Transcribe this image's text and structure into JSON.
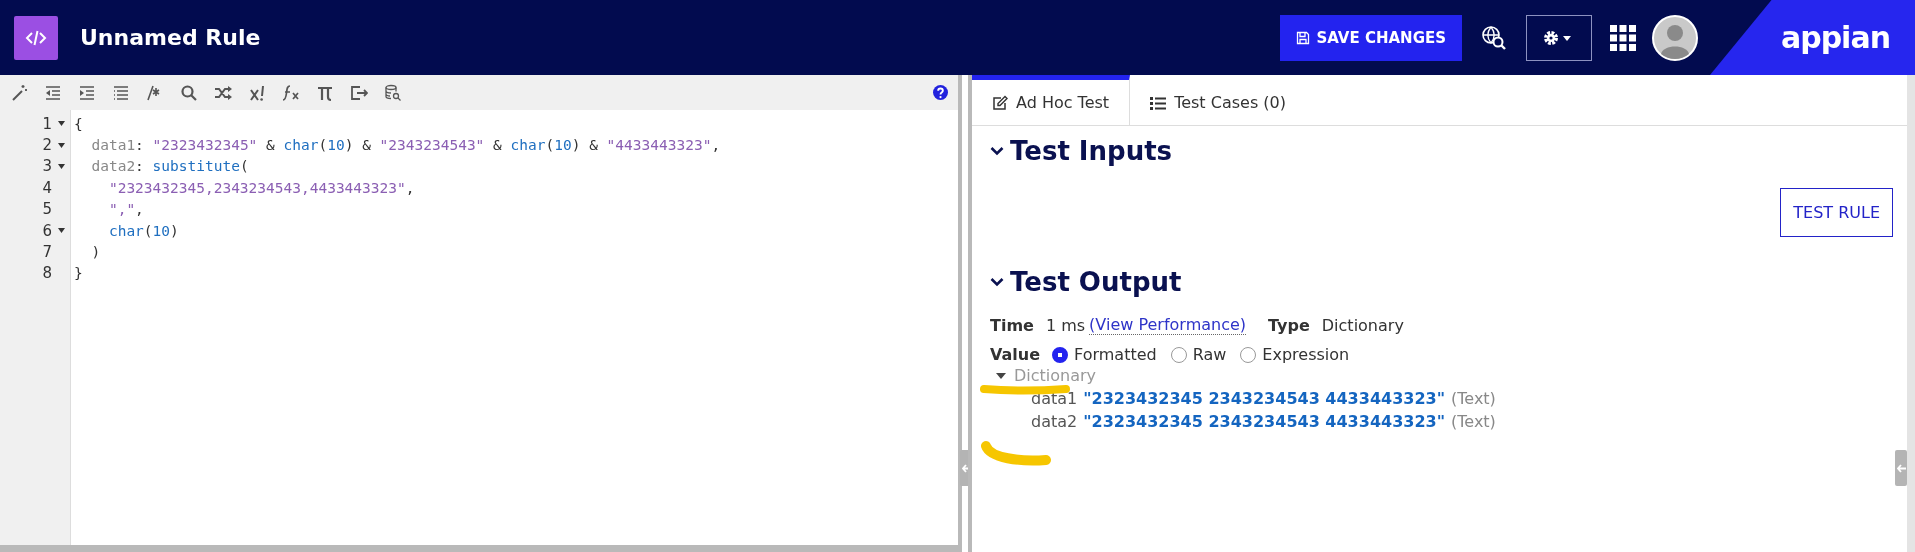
{
  "header": {
    "title": "Unnamed Rule",
    "save_button": "SAVE CHANGES",
    "brand": "appian"
  },
  "editor": {
    "lines": [
      {
        "number": "1",
        "foldable": true,
        "tokens": [
          {
            "kind": "punct",
            "text": "{"
          }
        ]
      },
      {
        "number": "2",
        "foldable": true,
        "tokens": [
          {
            "kind": "key",
            "text": "  data1"
          },
          {
            "kind": "punct",
            "text": ": "
          },
          {
            "kind": "string",
            "text": "\"2323432345\""
          },
          {
            "kind": "punct",
            "text": " & "
          },
          {
            "kind": "func",
            "text": "char"
          },
          {
            "kind": "punct",
            "text": "("
          },
          {
            "kind": "number",
            "text": "10"
          },
          {
            "kind": "punct",
            "text": ") & "
          },
          {
            "kind": "string",
            "text": "\"2343234543\""
          },
          {
            "kind": "punct",
            "text": " & "
          },
          {
            "kind": "func",
            "text": "char"
          },
          {
            "kind": "punct",
            "text": "("
          },
          {
            "kind": "number",
            "text": "10"
          },
          {
            "kind": "punct",
            "text": ") & "
          },
          {
            "kind": "string",
            "text": "\"4433443323\""
          },
          {
            "kind": "punct",
            "text": ","
          }
        ]
      },
      {
        "number": "3",
        "foldable": true,
        "tokens": [
          {
            "kind": "key",
            "text": "  data2"
          },
          {
            "kind": "punct",
            "text": ": "
          },
          {
            "kind": "func",
            "text": "substitute"
          },
          {
            "kind": "punct",
            "text": "("
          }
        ]
      },
      {
        "number": "4",
        "foldable": false,
        "tokens": [
          {
            "kind": "string",
            "text": "    \"2323432345,2343234543,4433443323\""
          },
          {
            "kind": "punct",
            "text": ","
          }
        ]
      },
      {
        "number": "5",
        "foldable": false,
        "tokens": [
          {
            "kind": "string",
            "text": "    \",\""
          },
          {
            "kind": "punct",
            "text": ","
          }
        ]
      },
      {
        "number": "6",
        "foldable": true,
        "tokens": [
          {
            "kind": "func",
            "text": "    char"
          },
          {
            "kind": "punct",
            "text": "("
          },
          {
            "kind": "number",
            "text": "10"
          },
          {
            "kind": "punct",
            "text": ")"
          }
        ]
      },
      {
        "number": "7",
        "foldable": false,
        "tokens": [
          {
            "kind": "punct",
            "text": "  )"
          }
        ]
      },
      {
        "number": "8",
        "foldable": false,
        "tokens": [
          {
            "kind": "punct",
            "text": "}"
          }
        ]
      }
    ]
  },
  "tabs": [
    {
      "label": "Ad Hoc Test",
      "selected": true
    },
    {
      "label": "Test Cases (0)",
      "selected": false
    }
  ],
  "test_inputs": {
    "heading": "Test Inputs",
    "button": "TEST RULE"
  },
  "test_output": {
    "heading": "Test Output",
    "time_label": "Time",
    "time": "1 ms",
    "performance_link": "(View Performance)",
    "type_label": "Type",
    "type": "Dictionary",
    "value_label": "Value",
    "views": [
      {
        "label": "Formatted",
        "selected": true
      },
      {
        "label": "Raw",
        "selected": false
      },
      {
        "label": "Expression",
        "selected": false
      }
    ],
    "result": {
      "label": "Dictionary",
      "expanded": true,
      "children": [
        {
          "key": "data1",
          "value": "\"2323432345 2343234543 4433443323\"",
          "type": "(Text)"
        },
        {
          "key": "data2",
          "value": "\"2323432345 2343234543 4433443323\"",
          "type": "(Text)"
        }
      ]
    }
  }
}
